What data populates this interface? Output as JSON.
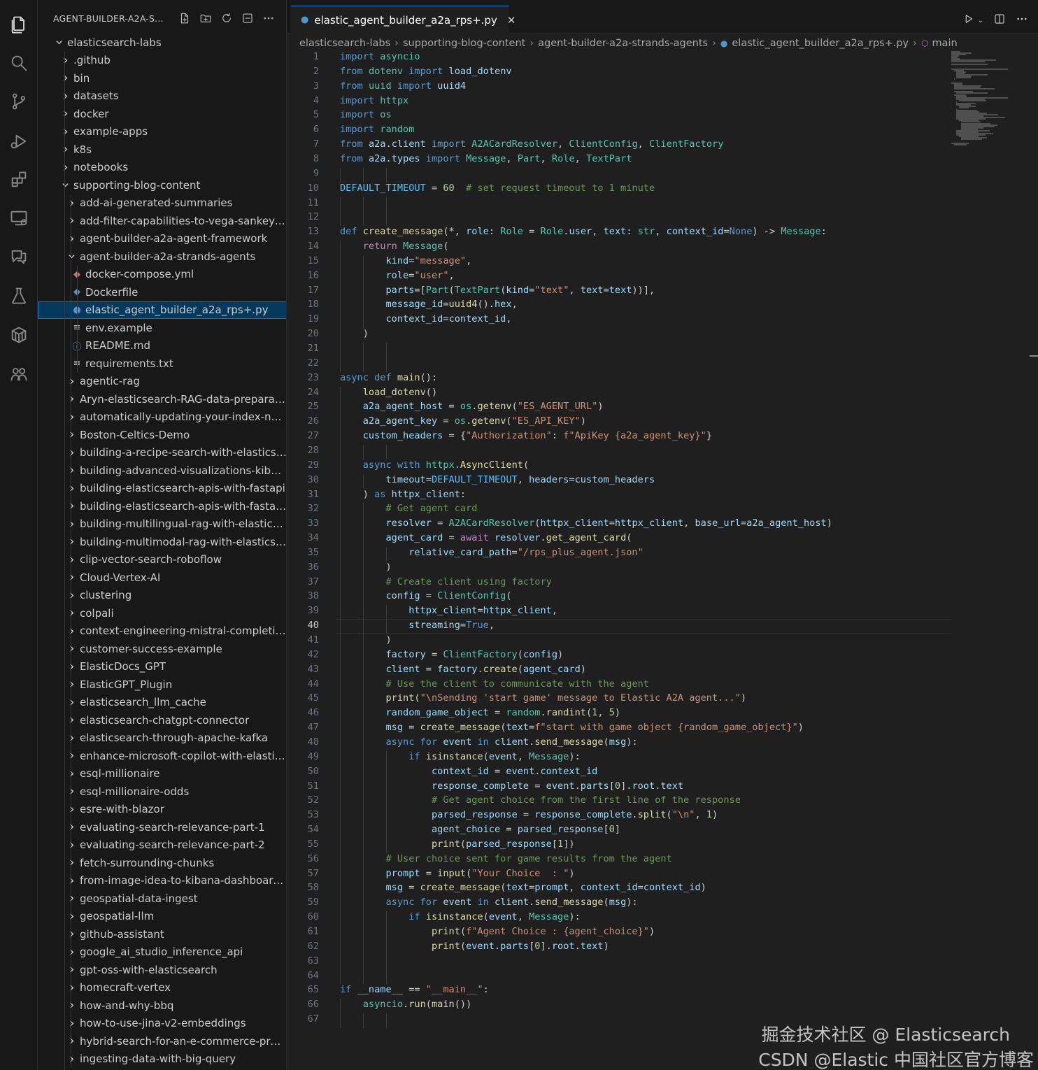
{
  "sidebar": {
    "title": "AGENT-BUILDER-A2A-S...",
    "tree": [
      {
        "label": "elasticsearch-labs",
        "depth": 0,
        "kind": "folder",
        "expanded": true
      },
      {
        "label": ".github",
        "depth": 1,
        "kind": "folder",
        "expanded": false
      },
      {
        "label": "bin",
        "depth": 1,
        "kind": "folder",
        "expanded": false
      },
      {
        "label": "datasets",
        "depth": 1,
        "kind": "folder",
        "expanded": false
      },
      {
        "label": "docker",
        "depth": 1,
        "kind": "folder",
        "expanded": false
      },
      {
        "label": "example-apps",
        "depth": 1,
        "kind": "folder",
        "expanded": false
      },
      {
        "label": "k8s",
        "depth": 1,
        "kind": "folder",
        "expanded": false
      },
      {
        "label": "notebooks",
        "depth": 1,
        "kind": "folder",
        "expanded": false
      },
      {
        "label": "supporting-blog-content",
        "depth": 1,
        "kind": "folder",
        "expanded": true
      },
      {
        "label": "add-ai-generated-summaries",
        "depth": 2,
        "kind": "folder",
        "expanded": false
      },
      {
        "label": "add-filter-capabilities-to-vega-sankey-c...",
        "depth": 2,
        "kind": "folder",
        "expanded": false
      },
      {
        "label": "agent-builder-a2a-agent-framework",
        "depth": 2,
        "kind": "folder",
        "expanded": false
      },
      {
        "label": "agent-builder-a2a-strands-agents",
        "depth": 2,
        "kind": "folder",
        "expanded": true
      },
      {
        "label": "docker-compose.yml",
        "depth": 3,
        "kind": "file",
        "icon": "docker-compose"
      },
      {
        "label": "Dockerfile",
        "depth": 3,
        "kind": "file",
        "icon": "docker"
      },
      {
        "label": "elastic_agent_builder_a2a_rps+.py",
        "depth": 3,
        "kind": "file",
        "icon": "python",
        "selected": true
      },
      {
        "label": "env.example",
        "depth": 3,
        "kind": "file",
        "icon": "text"
      },
      {
        "label": "README.md",
        "depth": 3,
        "kind": "file",
        "icon": "info"
      },
      {
        "label": "requirements.txt",
        "depth": 3,
        "kind": "file",
        "icon": "text"
      },
      {
        "label": "agentic-rag",
        "depth": 2,
        "kind": "folder",
        "expanded": false
      },
      {
        "label": "Aryn-elasticsearch-RAG-data-preparati...",
        "depth": 2,
        "kind": "folder",
        "expanded": false
      },
      {
        "label": "automatically-updating-your-index-nod...",
        "depth": 2,
        "kind": "folder",
        "expanded": false
      },
      {
        "label": "Boston-Celtics-Demo",
        "depth": 2,
        "kind": "folder",
        "expanded": false
      },
      {
        "label": "building-a-recipe-search-with-elasticse...",
        "depth": 2,
        "kind": "folder",
        "expanded": false
      },
      {
        "label": "building-advanced-visualizations-kibana...",
        "depth": 2,
        "kind": "folder",
        "expanded": false
      },
      {
        "label": "building-elasticsearch-apis-with-fastapi",
        "depth": 2,
        "kind": "folder",
        "expanded": false
      },
      {
        "label": "building-elasticsearch-apis-with-fastapi...",
        "depth": 2,
        "kind": "folder",
        "expanded": false
      },
      {
        "label": "building-multilingual-rag-with-elastic-an...",
        "depth": 2,
        "kind": "folder",
        "expanded": false
      },
      {
        "label": "building-multimodal-rag-with-elasticsea...",
        "depth": 2,
        "kind": "folder",
        "expanded": false
      },
      {
        "label": "clip-vector-search-roboflow",
        "depth": 2,
        "kind": "folder",
        "expanded": false
      },
      {
        "label": "Cloud-Vertex-AI",
        "depth": 2,
        "kind": "folder",
        "expanded": false
      },
      {
        "label": "clustering",
        "depth": 2,
        "kind": "folder",
        "expanded": false
      },
      {
        "label": "colpali",
        "depth": 2,
        "kind": "folder",
        "expanded": false
      },
      {
        "label": "context-engineering-mistral-completions",
        "depth": 2,
        "kind": "folder",
        "expanded": false
      },
      {
        "label": "customer-success-example",
        "depth": 2,
        "kind": "folder",
        "expanded": false
      },
      {
        "label": "ElasticDocs_GPT",
        "depth": 2,
        "kind": "folder",
        "expanded": false
      },
      {
        "label": "ElasticGPT_Plugin",
        "depth": 2,
        "kind": "folder",
        "expanded": false
      },
      {
        "label": "elasticsearch_llm_cache",
        "depth": 2,
        "kind": "folder",
        "expanded": false
      },
      {
        "label": "elasticsearch-chatgpt-connector",
        "depth": 2,
        "kind": "folder",
        "expanded": false
      },
      {
        "label": "elasticsearch-through-apache-kafka",
        "depth": 2,
        "kind": "folder",
        "expanded": false
      },
      {
        "label": "enhance-microsoft-copilot-with-elastics...",
        "depth": 2,
        "kind": "folder",
        "expanded": false
      },
      {
        "label": "esql-millionaire",
        "depth": 2,
        "kind": "folder",
        "expanded": false
      },
      {
        "label": "esql-millionaire-odds",
        "depth": 2,
        "kind": "folder",
        "expanded": false
      },
      {
        "label": "esre-with-blazor",
        "depth": 2,
        "kind": "folder",
        "expanded": false
      },
      {
        "label": "evaluating-search-relevance-part-1",
        "depth": 2,
        "kind": "folder",
        "expanded": false
      },
      {
        "label": "evaluating-search-relevance-part-2",
        "depth": 2,
        "kind": "folder",
        "expanded": false
      },
      {
        "label": "fetch-surrounding-chunks",
        "depth": 2,
        "kind": "folder",
        "expanded": false
      },
      {
        "label": "from-image-idea-to-kibana-dashboard-...",
        "depth": 2,
        "kind": "folder",
        "expanded": false
      },
      {
        "label": "geospatial-data-ingest",
        "depth": 2,
        "kind": "folder",
        "expanded": false
      },
      {
        "label": "geospatial-llm",
        "depth": 2,
        "kind": "folder",
        "expanded": false
      },
      {
        "label": "github-assistant",
        "depth": 2,
        "kind": "folder",
        "expanded": false
      },
      {
        "label": "google_ai_studio_inference_api",
        "depth": 2,
        "kind": "folder",
        "expanded": false
      },
      {
        "label": "gpt-oss-with-elasticsearch",
        "depth": 2,
        "kind": "folder",
        "expanded": false
      },
      {
        "label": "homecraft-vertex",
        "depth": 2,
        "kind": "folder",
        "expanded": false
      },
      {
        "label": "how-and-why-bbq",
        "depth": 2,
        "kind": "folder",
        "expanded": false
      },
      {
        "label": "how-to-use-jina-v2-embeddings",
        "depth": 2,
        "kind": "folder",
        "expanded": false
      },
      {
        "label": "hybrid-search-for-an-e-commerce-prod...",
        "depth": 2,
        "kind": "folder",
        "expanded": false
      },
      {
        "label": "ingesting-data-with-big-query",
        "depth": 2,
        "kind": "folder",
        "expanded": false
      }
    ]
  },
  "editor": {
    "tab_label": "elastic_agent_builder_a2a_rps+.py",
    "breadcrumbs": [
      "elasticsearch-labs",
      "supporting-blog-content",
      "agent-builder-a2a-strands-agents",
      "elastic_agent_builder_a2a_rps+.py",
      "main"
    ],
    "current_line": 40,
    "code": [
      "import asyncio",
      "from dotenv import load_dotenv",
      "from uuid import uuid4",
      "import httpx",
      "import os",
      "import random",
      "from a2a.client import A2ACardResolver, ClientConfig, ClientFactory",
      "from a2a.types import Message, Part, Role, TextPart",
      "",
      "DEFAULT_TIMEOUT = 60  # set request timeout to 1 minute",
      "",
      "",
      "def create_message(*, role: Role = Role.user, text: str, context_id=None) -> Message:",
      "    return Message(",
      "        kind=\"message\",",
      "        role=\"user\",",
      "        parts=[Part(TextPart(kind=\"text\", text=text))],",
      "        message_id=uuid4().hex,",
      "        context_id=context_id,",
      "    )",
      "",
      "",
      "async def main():",
      "    load_dotenv()",
      "    a2a_agent_host = os.getenv(\"ES_AGENT_URL\")",
      "    a2a_agent_key = os.getenv(\"ES_API_KEY\")",
      "    custom_headers = {\"Authorization\": f\"ApiKey {a2a_agent_key}\"}",
      "",
      "    async with httpx.AsyncClient(",
      "        timeout=DEFAULT_TIMEOUT, headers=custom_headers",
      "    ) as httpx_client:",
      "        # Get agent card",
      "        resolver = A2ACardResolver(httpx_client=httpx_client, base_url=a2a_agent_host)",
      "        agent_card = await resolver.get_agent_card(",
      "            relative_card_path=\"/rps_plus_agent.json\"",
      "        )",
      "        # Create client using factory",
      "        config = ClientConfig(",
      "            httpx_client=httpx_client,",
      "            streaming=True,",
      "        )",
      "        factory = ClientFactory(config)",
      "        client = factory.create(agent_card)",
      "        # Use the client to communicate with the agent",
      "        print(\"\\nSending 'start game' message to Elastic A2A agent...\")",
      "        random_game_object = random.randint(1, 5)",
      "        msg = create_message(text=f\"start with game object {random_game_object}\")",
      "        async for event in client.send_message(msg):",
      "            if isinstance(event, Message):",
      "                context_id = event.context_id",
      "                response_complete = event.parts[0].root.text",
      "                # Get agent choice from the first line of the response",
      "                parsed_response = response_complete.split(\"\\n\", 1)",
      "                agent_choice = parsed_response[0]",
      "                print(parsed_response[1])",
      "        # User choice sent for game results from the agent",
      "        prompt = input(\"Your Choice  : \")",
      "        msg = create_message(text=prompt, context_id=context_id)",
      "        async for event in client.send_message(msg):",
      "            if isinstance(event, Message):",
      "                print(f\"Agent Choice : {agent_choice}\")",
      "                print(event.parts[0].root.text)",
      "",
      "",
      "if __name__ == \"__main__\":",
      "    asyncio.run(main())",
      ""
    ]
  },
  "watermark": {
    "line1": "掘金技术社区 @ Elasticsearch",
    "line2": "CSDN @Elastic 中国社区官方博客"
  },
  "icons": {
    "activity": [
      "explorer-icon",
      "search-icon",
      "source-control-icon",
      "run-debug-icon",
      "extensions-icon",
      "remote-explorer-icon",
      "chat-icon",
      "testing-icon",
      "containers-icon",
      "accounts-icon"
    ]
  }
}
